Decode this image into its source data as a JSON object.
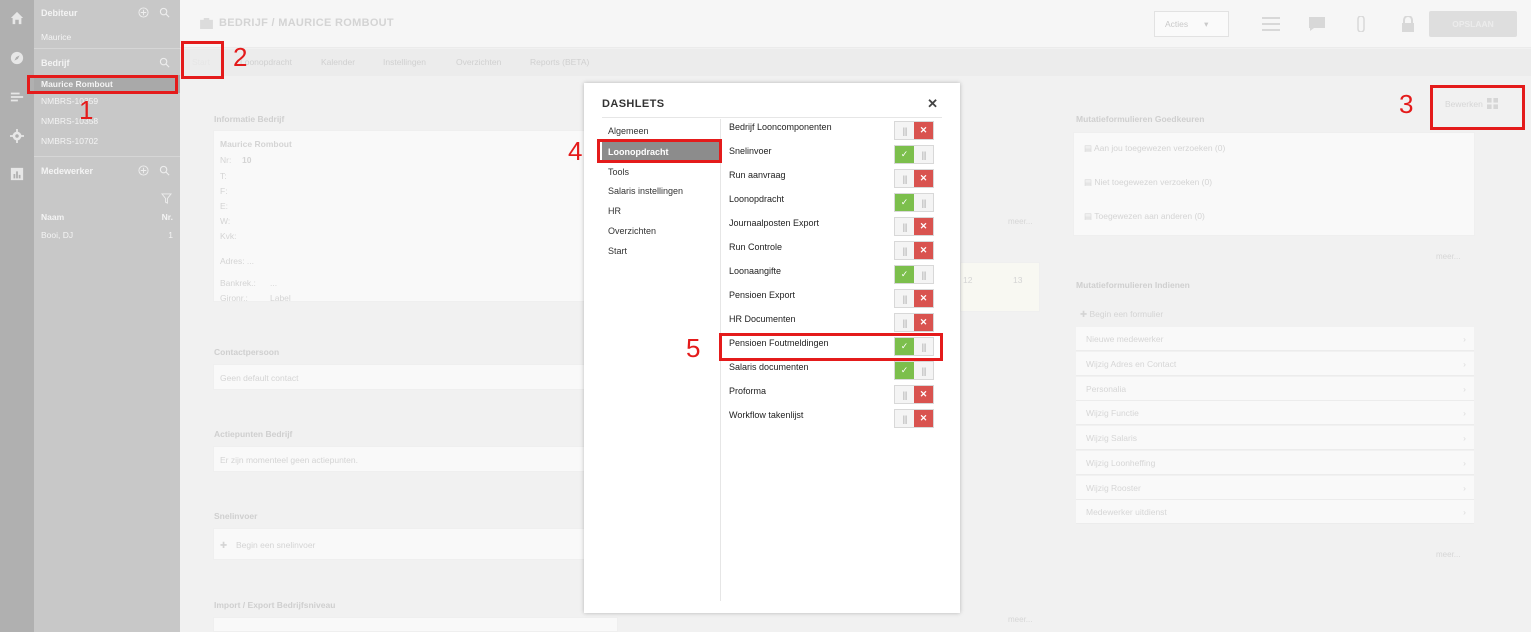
{
  "header": {
    "title": "BEDRIJF / MAURICE ROMBOUT",
    "acties_label": "Acties",
    "save_label": "OPSLAAN"
  },
  "sidebar": {
    "debiteur": {
      "label": "Debiteur",
      "item": "Maurice"
    },
    "bedrijf": {
      "label": "Bedrijf",
      "items": [
        "Maurice Rombout",
        "NMBRS-10359",
        "NMBRS-10358",
        "NMBRS-10702"
      ]
    },
    "medewerker": {
      "label": "Medewerker",
      "col_name": "Naam",
      "col_nr": "Nr.",
      "rows": [
        {
          "name": "Booi, DJ",
          "nr": "1"
        }
      ]
    }
  },
  "tabs": [
    "Start",
    "Loonopdracht",
    "Kalender",
    "Instellingen",
    "Overzichten",
    "Reports (BETA)"
  ],
  "background": {
    "informatie_title": "Informatie Bedrijf",
    "company_name": "Maurice Rombout",
    "fields": [
      "Nr:",
      "T:",
      "F:",
      "E:",
      "W:",
      "Kvk:"
    ],
    "nr_value": "10",
    "adres": "Adres: ...",
    "bankrek": "Bankrek.:",
    "bankrek_value": "...",
    "gironr": "Gironr.:",
    "gironr_value": "Label",
    "contact_title": "Contactpersoon",
    "contact_text": "Geen default contact",
    "actie_title": "Actiepunten Bedrijf",
    "actie_text": "Er zijn momenteel geen actiepunten.",
    "snel_title": "Snelinvoer",
    "snel_text": "Begin een snelinvoer",
    "import_title": "Import / Export Bedrijfsniveau",
    "meer": "meer...",
    "bewerken": "Bewerken",
    "goedkeuren_title": "Mutatieformulieren Goedkeuren",
    "goedkeuren_items": [
      "Aan jou toegewezen verzoeken (0)",
      "Niet toegewezen verzoeken (0)",
      "Toegewezen aan anderen (0)"
    ],
    "indienen_title": "Mutatieformulieren Indienen",
    "indienen_start": "Begin een formulier",
    "indienen_items": [
      "Nieuwe medewerker",
      "Wijzig Adres en Contact",
      "Personalia",
      "Wijzig Functie",
      "Wijzig Salaris",
      "Wijzig Loonheffing",
      "Wijzig Rooster",
      "Medewerker uitdienst"
    ],
    "cal_nums": [
      "12",
      "13"
    ]
  },
  "modal": {
    "title": "DASHLETS",
    "categories": [
      "Algemeen",
      "Loonopdracht",
      "Tools",
      "Salaris instellingen",
      "HR",
      "Overzichten",
      "Start"
    ],
    "selected_category": "Loonopdracht",
    "dashlets": [
      {
        "label": "Bedrijf Looncomponenten",
        "on": false
      },
      {
        "label": "Snelinvoer",
        "on": true
      },
      {
        "label": "Run aanvraag",
        "on": false
      },
      {
        "label": "Loonopdracht",
        "on": true
      },
      {
        "label": "Journaalposten Export",
        "on": false
      },
      {
        "label": "Run Controle",
        "on": false
      },
      {
        "label": "Loonaangifte",
        "on": true
      },
      {
        "label": "Pensioen Export",
        "on": false
      },
      {
        "label": "HR Documenten",
        "on": false
      },
      {
        "label": "Pensioen Foutmeldingen",
        "on": true
      },
      {
        "label": "Salaris documenten",
        "on": true
      },
      {
        "label": "Proforma",
        "on": false
      },
      {
        "label": "Workflow takenlijst",
        "on": false
      }
    ]
  },
  "annotations": [
    "1",
    "2",
    "3",
    "4",
    "5"
  ],
  "colors": {
    "annotation": "#e41b1b",
    "toggle_on": "#7cbf4c",
    "toggle_off": "#d9534f",
    "selected_category": "#8c8c8c"
  }
}
